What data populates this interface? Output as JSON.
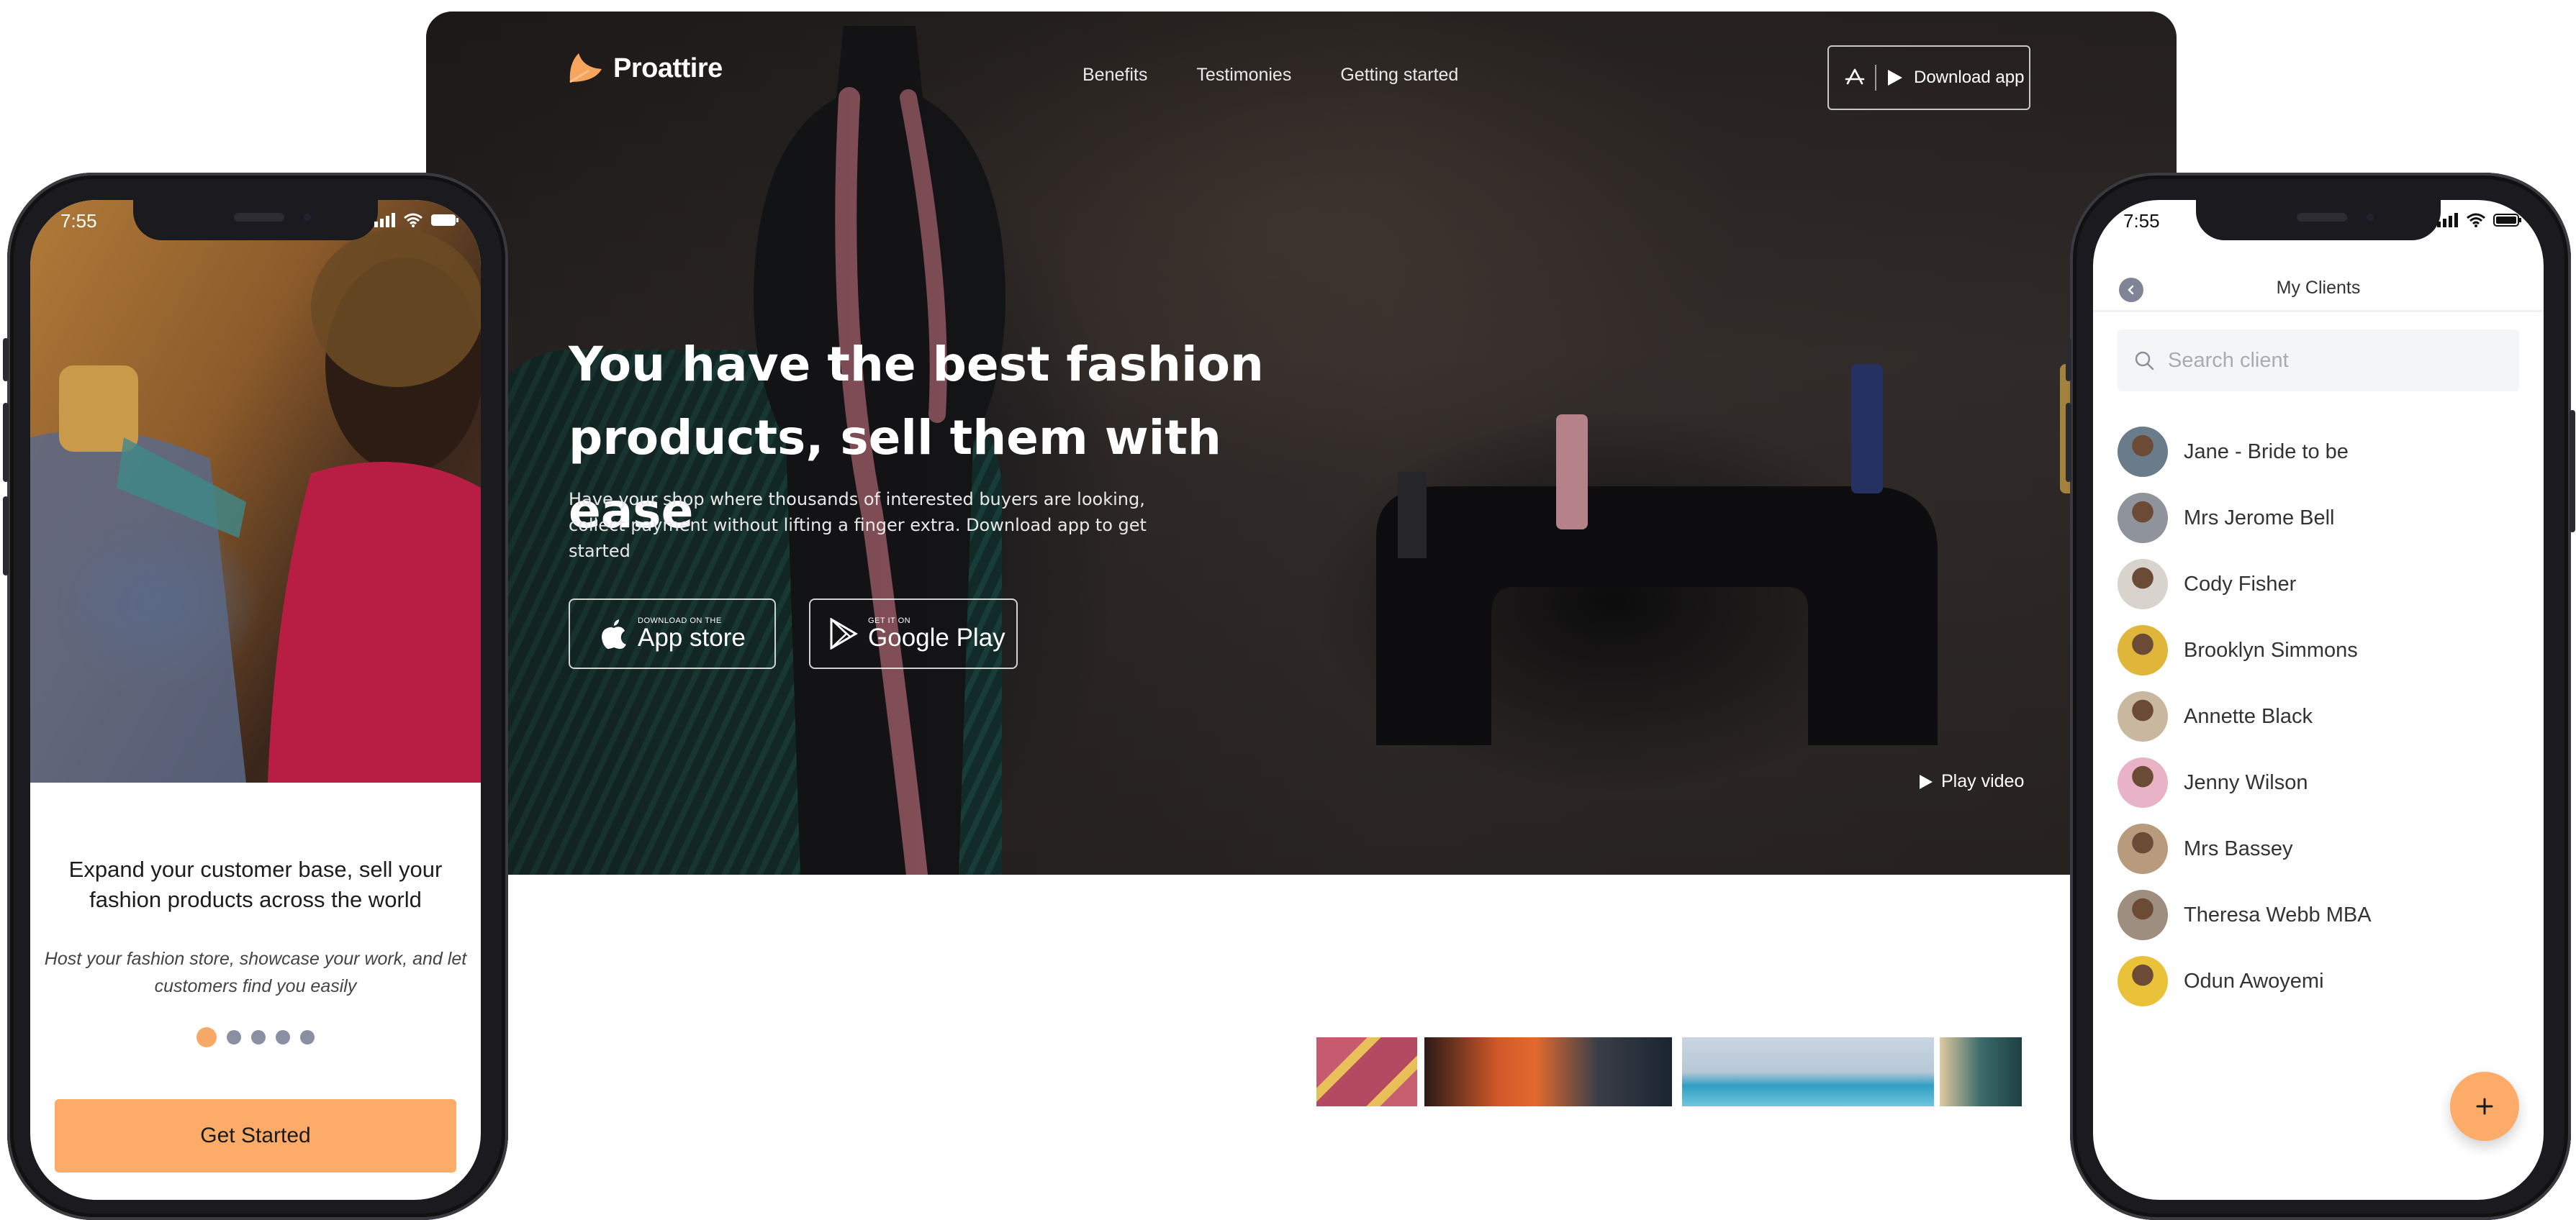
{
  "desktop": {
    "logo": {
      "text": "Proattire"
    },
    "nav": [
      {
        "label": "Benefits"
      },
      {
        "label": "Testimonies"
      },
      {
        "label": "Getting started"
      }
    ],
    "download_button": {
      "label": "Download app"
    },
    "hero": {
      "headline_line1": "You have the best fashion",
      "headline_line2": "products, sell them with ease",
      "subline": "Have your shop where thousands of interested buyers are looking, collect payment without lifting a finger extra. Download app to get started",
      "app_store": {
        "small": "DOWNLOAD ON THE",
        "big": "App store"
      },
      "google_play": {
        "small": "GET IT ON",
        "big": "Google Play"
      },
      "play_video": "Play video"
    }
  },
  "left_phone": {
    "status_time": "7:55",
    "title": "Expand your customer base, sell your fashion products across the world",
    "description": "Host your fashion store, showcase your work, and let customers find you easily",
    "dots": {
      "total": 5,
      "active_index": 0
    },
    "cta": "Get Started"
  },
  "right_phone": {
    "status_time": "7:55",
    "title": "My Clients",
    "search_placeholder": "Search client",
    "clients": [
      {
        "name": "Jane - Bride to be",
        "avatar_color": "#6a7b8a"
      },
      {
        "name": "Mrs Jerome Bell",
        "avatar_color": "#8f939b"
      },
      {
        "name": "Cody Fisher",
        "avatar_color": "#d8d3cc"
      },
      {
        "name": "Brooklyn Simmons",
        "avatar_color": "#e0b63a"
      },
      {
        "name": "Annette Black",
        "avatar_color": "#c9b79f"
      },
      {
        "name": "Jenny Wilson",
        "avatar_color": "#e8b3c6"
      },
      {
        "name": "Mrs Bassey",
        "avatar_color": "#b79b7c"
      },
      {
        "name": "Theresa Webb MBA",
        "avatar_color": "#9d8e7f"
      },
      {
        "name": "Odun Awoyemi",
        "avatar_color": "#e9c23a"
      }
    ]
  },
  "colors": {
    "accent": "#fcab69",
    "dot_inactive": "#8a8fa2"
  }
}
